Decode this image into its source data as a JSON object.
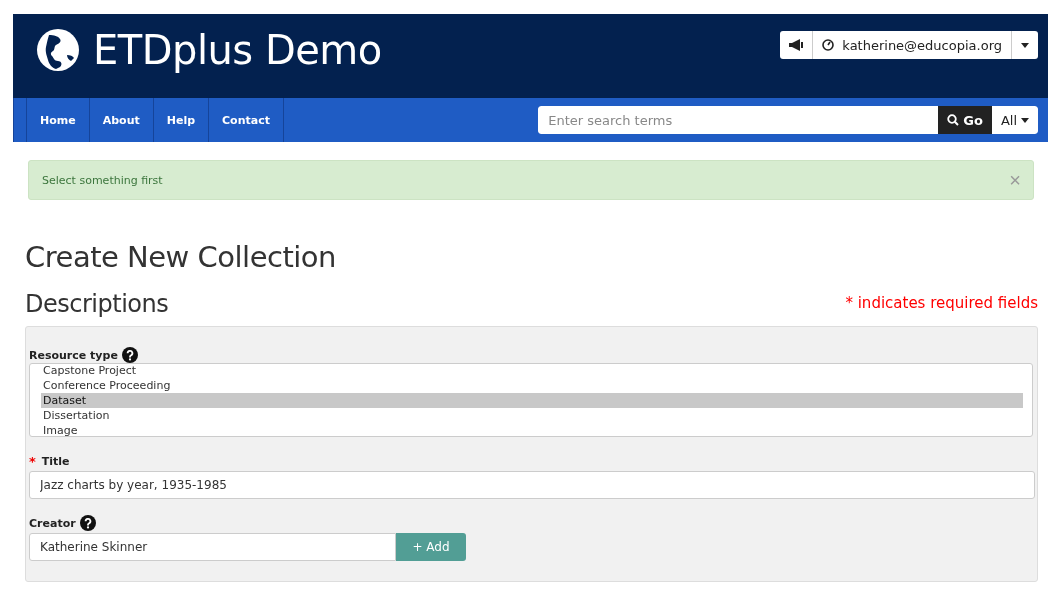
{
  "site": {
    "title": "ETDplus Demo"
  },
  "user_menu": {
    "email": "katherine@educopia.org"
  },
  "nav": {
    "items": [
      {
        "label": "Home"
      },
      {
        "label": "About"
      },
      {
        "label": "Help"
      },
      {
        "label": "Contact"
      }
    ]
  },
  "search": {
    "placeholder": "Enter search terms",
    "button": "Go",
    "scope": "All"
  },
  "alert": {
    "message": "Select something first",
    "close": "×"
  },
  "page": {
    "title": "Create New Collection",
    "section": "Descriptions",
    "required_note": "* indicates required fields"
  },
  "form": {
    "resource_type": {
      "label": "Resource type",
      "help": true,
      "options": [
        {
          "label": "Capstone Project",
          "selected": false
        },
        {
          "label": "Conference Proceeding",
          "selected": false
        },
        {
          "label": "Dataset",
          "selected": true
        },
        {
          "label": "Dissertation",
          "selected": false
        },
        {
          "label": "Image",
          "selected": false
        }
      ]
    },
    "title": {
      "label": "Title",
      "required": true,
      "required_mark": "*",
      "value": "Jazz charts by year, 1935-1985"
    },
    "creator": {
      "label": "Creator",
      "help": true,
      "value": "Katherine Skinner",
      "add_button": "+ Add"
    }
  }
}
